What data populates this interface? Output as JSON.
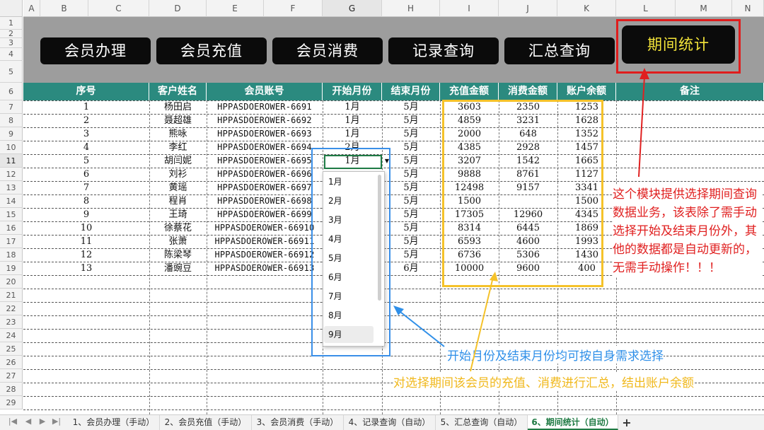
{
  "column_headers": [
    "A",
    "B",
    "C",
    "D",
    "E",
    "F",
    "G",
    "H",
    "I",
    "J",
    "K",
    "L",
    "M",
    "N"
  ],
  "row_numbers": [
    "1",
    "2",
    "3",
    "4",
    "5",
    "6",
    "7",
    "8",
    "9",
    "10",
    "11",
    "12",
    "13",
    "14",
    "15",
    "16",
    "17",
    "18",
    "19",
    "20",
    "21",
    "22",
    "23",
    "24",
    "25",
    "26",
    "27",
    "28",
    "29"
  ],
  "nav_buttons": [
    "会员办理",
    "会员充值",
    "会员消费",
    "记录查询",
    "汇总查询",
    "期间统计"
  ],
  "table_headers": [
    "序号",
    "客户姓名",
    "会员账号",
    "开始月份",
    "结束月份",
    "充值金额",
    "消费金额",
    "账户余额",
    "备注"
  ],
  "rows": [
    {
      "no": "1",
      "name": "杨田启",
      "account": "HPPASDOEROWER-6691",
      "start": "1月",
      "end": "5月",
      "recharge": "3603",
      "consume": "2350",
      "balance": "1253"
    },
    {
      "no": "2",
      "name": "聂超雄",
      "account": "HPPASDOEROWER-6692",
      "start": "1月",
      "end": "5月",
      "recharge": "4859",
      "consume": "3231",
      "balance": "1628"
    },
    {
      "no": "3",
      "name": "熊咏",
      "account": "HPPASDOEROWER-6693",
      "start": "1月",
      "end": "5月",
      "recharge": "2000",
      "consume": "648",
      "balance": "1352"
    },
    {
      "no": "4",
      "name": "李红",
      "account": "HPPASDOEROWER-6694",
      "start": "2月",
      "end": "5月",
      "recharge": "4385",
      "consume": "2928",
      "balance": "1457"
    },
    {
      "no": "5",
      "name": "胡闫妮",
      "account": "HPPASDOEROWER-6695",
      "start": "1月",
      "end": "5月",
      "recharge": "3207",
      "consume": "1542",
      "balance": "1665"
    },
    {
      "no": "6",
      "name": "刘衫",
      "account": "HPPASDOEROWER-6696",
      "start": "",
      "end": "5月",
      "recharge": "9888",
      "consume": "8761",
      "balance": "1127"
    },
    {
      "no": "7",
      "name": "黄瑶",
      "account": "HPPASDOEROWER-6697",
      "start": "",
      "end": "5月",
      "recharge": "12498",
      "consume": "9157",
      "balance": "3341"
    },
    {
      "no": "8",
      "name": "程肖",
      "account": "HPPASDOEROWER-6698",
      "start": "",
      "end": "5月",
      "recharge": "1500",
      "consume": "",
      "balance": "1500"
    },
    {
      "no": "9",
      "name": "王琦",
      "account": "HPPASDOEROWER-6699",
      "start": "",
      "end": "5月",
      "recharge": "17305",
      "consume": "12960",
      "balance": "4345"
    },
    {
      "no": "10",
      "name": "徐蔡花",
      "account": "HPPASDOEROWER-66910",
      "start": "",
      "end": "5月",
      "recharge": "8314",
      "consume": "6445",
      "balance": "1869"
    },
    {
      "no": "11",
      "name": "张萧",
      "account": "HPPASDOEROWER-66911",
      "start": "",
      "end": "5月",
      "recharge": "6593",
      "consume": "4600",
      "balance": "1993"
    },
    {
      "no": "12",
      "name": "陈梁琴",
      "account": "HPPASDOEROWER-66912",
      "start": "",
      "end": "5月",
      "recharge": "6736",
      "consume": "5306",
      "balance": "1430"
    },
    {
      "no": "13",
      "name": "潘豌豆",
      "account": "HPPASDOEROWER-66913",
      "start": "",
      "end": "6月",
      "recharge": "10000",
      "consume": "9600",
      "balance": "400"
    }
  ],
  "dropdown_options": [
    "1月",
    "2月",
    "3月",
    "4月",
    "5月",
    "6月",
    "7月",
    "8月",
    "9月"
  ],
  "annotations": {
    "red": "这个模块提供选择期间查询数据业务，该表除了需手动选择开始及结束月份外，其他的数据都是自动更新的，无需手动操作！！！",
    "blue": "开始月份及结束月份均可按自身需求选择",
    "yellow": "对选择期间该会员的充值、消费进行汇总，结出账户余额"
  },
  "sheet_tabs": [
    "1、会员办理（手动）",
    "2、会员充值（手动）",
    "3、会员消费（手动）",
    "4、记录查询（自动）",
    "5、汇总查询（自动）",
    "6、期间统计（自动）"
  ],
  "nav_icons": [
    "first-sheet-icon",
    "prev-sheet-icon",
    "next-sheet-icon",
    "last-sheet-icon"
  ],
  "add_sheet_icon": "plus-icon",
  "colors": {
    "header_teal": "#2b8a7f",
    "band_gray": "#9d9d9d",
    "active_text": "#f4e53a",
    "red": "#e02020",
    "blue": "#2f8fe8",
    "yellow": "#f5c22a"
  }
}
